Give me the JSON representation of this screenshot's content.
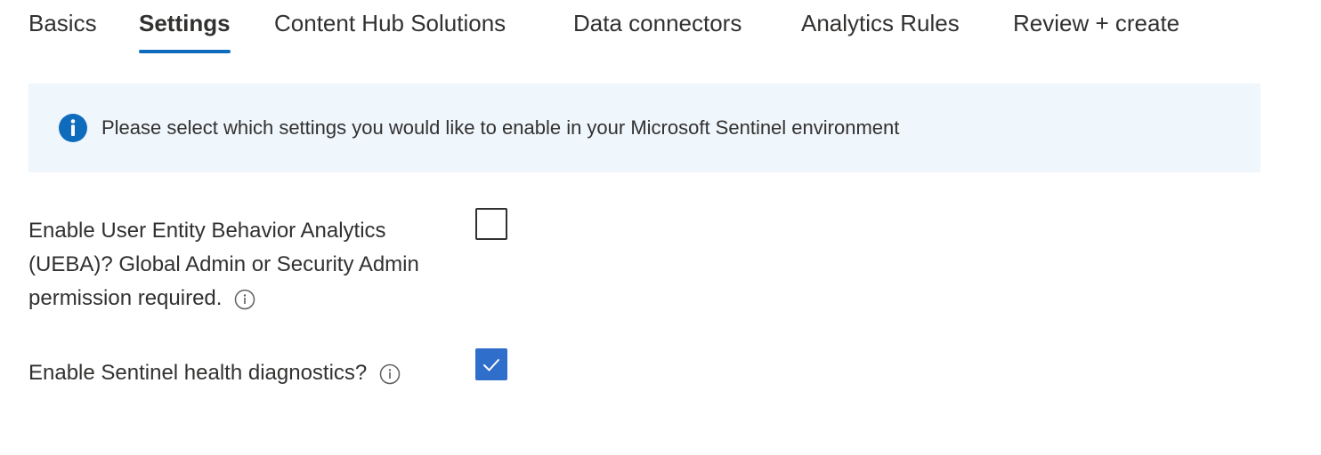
{
  "tabs": [
    {
      "label": "Basics",
      "active": false
    },
    {
      "label": "Settings",
      "active": true
    },
    {
      "label": "Content Hub Solutions",
      "active": false
    },
    {
      "label": "Data connectors",
      "active": false
    },
    {
      "label": "Analytics Rules",
      "active": false
    },
    {
      "label": "Review + create",
      "active": false
    }
  ],
  "banner": {
    "icon": "info-filled-icon",
    "text": "Please select which settings you would like to enable in your Microsoft Sentinel environment"
  },
  "settings": [
    {
      "label_lines": [
        "Enable User Entity Behavior Analytics",
        "(UEBA)? Global Admin or Security Admin",
        "permission required."
      ],
      "info_icon": "info-outline-icon",
      "checked": false
    },
    {
      "label_lines": [
        "Enable Sentinel health diagnostics?"
      ],
      "info_icon": "info-outline-icon",
      "checked": true
    }
  ],
  "colors": {
    "accent": "#0f6cbd",
    "checkbox_checked": "#2f6fcb",
    "banner_background": "#eff6fc",
    "text": "#323130"
  }
}
